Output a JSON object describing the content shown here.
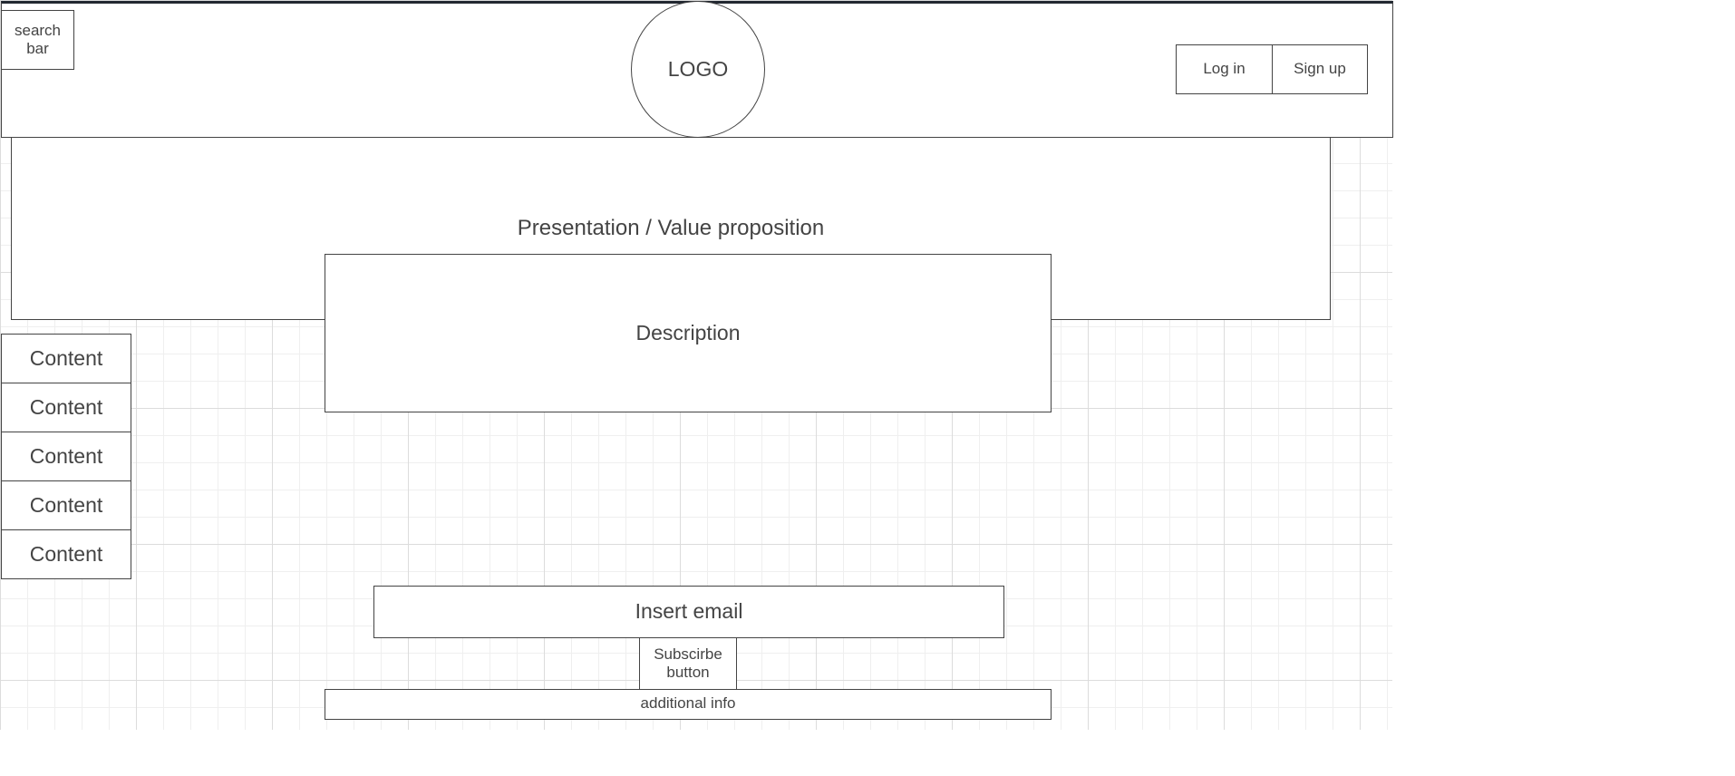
{
  "header": {
    "search_label": "search bar",
    "logo_label": "LOGO",
    "login_label": "Log in",
    "signup_label": "Sign up"
  },
  "hero": {
    "title": "Presentation / Value proposition",
    "description": "Description"
  },
  "sidebar": {
    "items": [
      {
        "label": "Content"
      },
      {
        "label": "Content"
      },
      {
        "label": "Content"
      },
      {
        "label": "Content"
      },
      {
        "label": "Content"
      }
    ]
  },
  "subscribe": {
    "email_label": "Insert email",
    "button_label": "Subscirbe button",
    "info_label": "additional info"
  }
}
